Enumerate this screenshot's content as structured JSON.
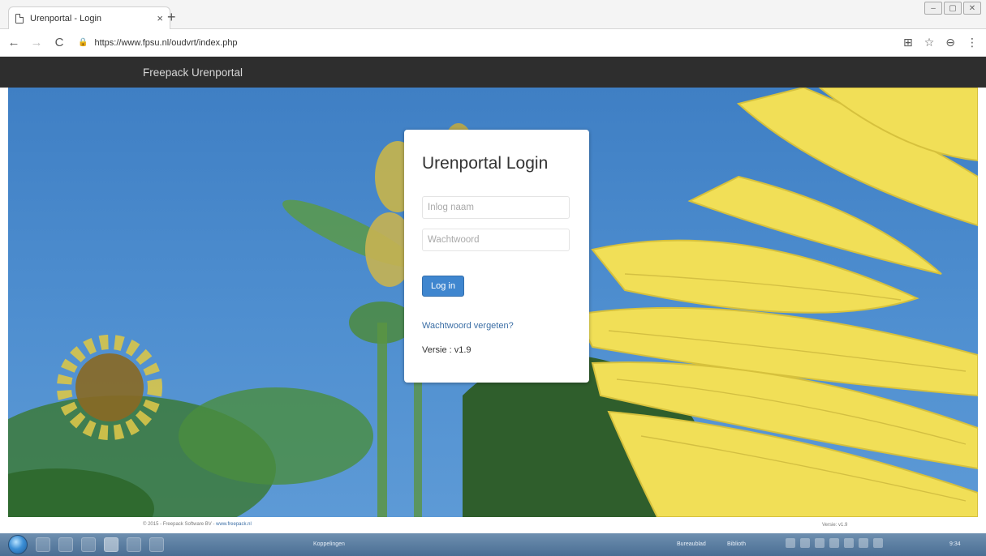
{
  "browser": {
    "tab_title": "Urenportal - Login",
    "tab_close": "×",
    "new_tab": "+",
    "url": "https://www.fpsu.nl/oudvrt/index.php",
    "back": "←",
    "forward": "→",
    "reload": "C",
    "icons": [
      "page-icon",
      "lock-icon",
      "translate-icon",
      "star-icon",
      "account-icon",
      "menu-icon"
    ]
  },
  "navbar": {
    "brand": "Freepack Urenportal"
  },
  "login": {
    "title": "Urenportal Login",
    "username_placeholder": "Inlog naam",
    "password_placeholder": "Wachtwoord",
    "submit_label": "Log in",
    "forgot_link": "Wachtwoord vergeten?",
    "version": "Versie : v1.9"
  },
  "footer": {
    "copyright": "© 2015 - Freepack Software BV - ",
    "link": "www.freepack.nl",
    "version": "Versie: v1.9"
  },
  "taskbar": {
    "koppelingen": "Koppelingen",
    "bureaublad": "Bureaublad",
    "bibliotheek": "Biblioth",
    "clock": "9:34"
  },
  "colors": {
    "navbar_bg": "#2e2e2e",
    "button_primary": "#3f86cf",
    "link": "#3b6ea5",
    "sky": "#4f8fd0",
    "petal": "#f4e35c"
  }
}
